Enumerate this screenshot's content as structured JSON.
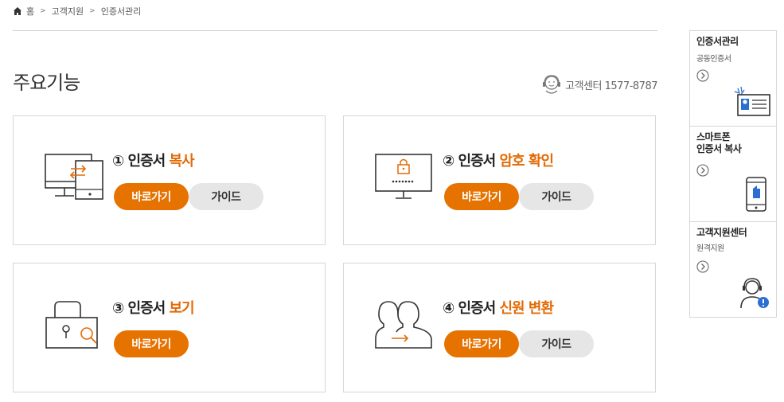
{
  "breadcrumb": {
    "home": "홈",
    "level1": "고객지원",
    "level2": "인증서관리"
  },
  "page": {
    "title": "주요기능",
    "customer_center": "고객센터 1577-8787"
  },
  "cards": [
    {
      "number": "①",
      "prefix": "인증서",
      "accent": "복사",
      "go": "바로가기",
      "guide": "가이드",
      "icon": "computer-transfer-icon"
    },
    {
      "number": "②",
      "prefix": "인증서",
      "accent": "암호 확인",
      "go": "바로가기",
      "guide": "가이드",
      "icon": "monitor-lock-icon"
    },
    {
      "number": "③",
      "prefix": "인증서",
      "accent": "보기",
      "go": "바로가기",
      "icon": "lock-magnifier-icon"
    },
    {
      "number": "④",
      "prefix": "인증서",
      "accent": "신원 변환",
      "go": "바로가기",
      "guide": "가이드",
      "icon": "people-transfer-icon"
    }
  ],
  "sidebar": [
    {
      "title": "인증서관리",
      "sub": "공동인증서",
      "icon": "id-card-icon"
    },
    {
      "title1": "스마트폰",
      "title2": "인증서 복사",
      "icon": "smartphone-icon"
    },
    {
      "title": "고객지원센터",
      "sub": "원격지원",
      "icon": "support-agent-icon"
    }
  ],
  "colors": {
    "accent": "#e26b07",
    "button_primary": "#e67200",
    "button_secondary": "#e6e6e6",
    "border": "#d6d6d6"
  }
}
